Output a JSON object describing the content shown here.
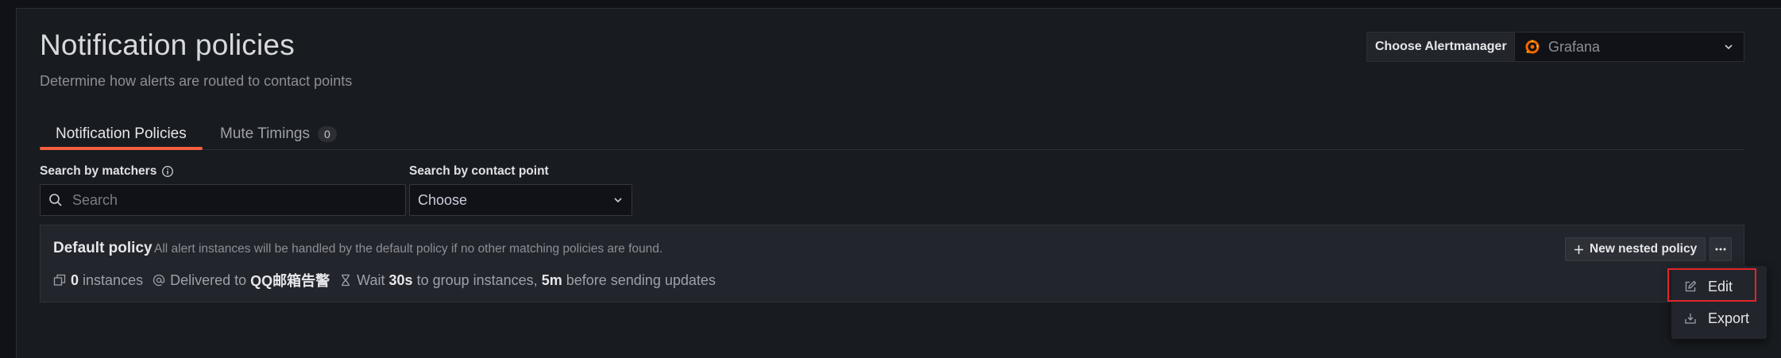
{
  "header": {
    "title": "Notification policies",
    "subtitle": "Determine how alerts are routed to contact points"
  },
  "alertmanager": {
    "label": "Choose Alertmanager",
    "selected": "Grafana",
    "logo_color": "#f46800"
  },
  "tabs": [
    {
      "label": "Notification Policies",
      "active": true
    },
    {
      "label": "Mute Timings",
      "count": "0",
      "active": false
    }
  ],
  "filters": {
    "matchers_label": "Search by matchers",
    "matchers_placeholder": "Search",
    "contact_label": "Search by contact point",
    "contact_value": "Choose"
  },
  "policy": {
    "name": "Default policy",
    "description": "All alert instances will be handled by the default policy if no other matching policies are found.",
    "instances_count": "0",
    "instances_label": "instances",
    "delivered_label": "Delivered to",
    "contact_point": "QQ邮箱告警",
    "wait_label": "Wait",
    "group_wait": "30s",
    "group_text": "to group instances,",
    "repeat_interval": "5m",
    "repeat_text": "before sending updates",
    "new_nested_label": "New nested policy"
  },
  "menu": {
    "items": [
      {
        "label": "Edit",
        "icon": "edit-icon",
        "highlighted": true
      },
      {
        "label": "Export",
        "icon": "download-icon"
      }
    ]
  },
  "colors": {
    "accent": "#f55f3e",
    "highlight": "#e0262c",
    "background": "#181b1f"
  }
}
